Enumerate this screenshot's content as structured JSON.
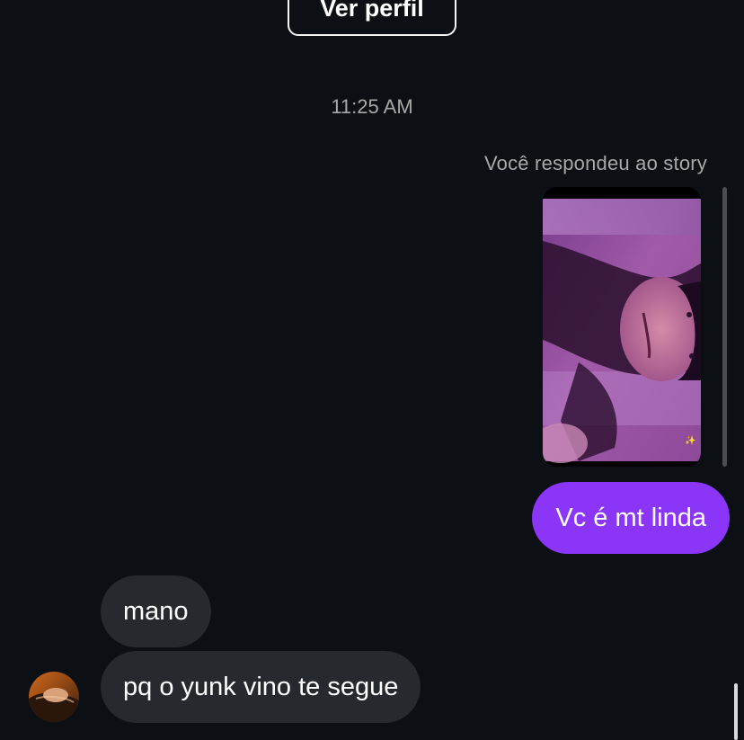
{
  "header": {
    "view_profile_label": "Ver perfil"
  },
  "thread": {
    "timestamp": "11:25 AM",
    "story_reply_label": "Você respondeu ao story",
    "messages": [
      {
        "direction": "outgoing",
        "text": "Vc é mt linda"
      },
      {
        "direction": "incoming",
        "text": "mano"
      },
      {
        "direction": "incoming",
        "text": "pq o yunk vino te segue"
      }
    ]
  },
  "colors": {
    "background": "#0c1014",
    "outgoing_bubble": "#8a35f7",
    "incoming_bubble": "#262a2f",
    "secondary_text": "#a8a8a8"
  },
  "icons": {
    "story_sparkle": "sparkle-icon"
  }
}
